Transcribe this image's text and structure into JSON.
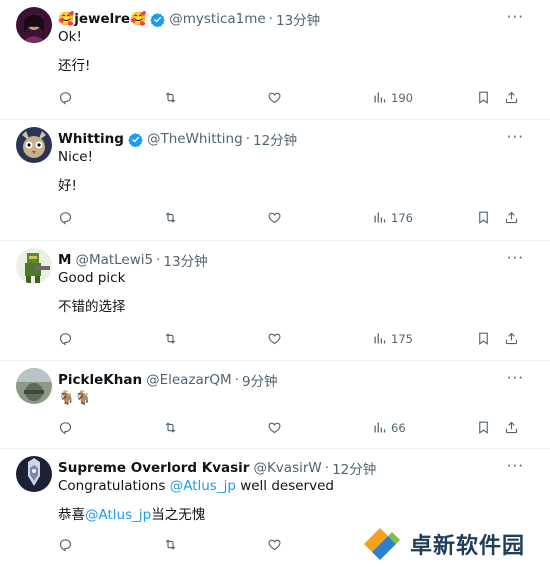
{
  "tweets": [
    {
      "name_prefix_emoji": "🥰",
      "name": "jewelre",
      "name_suffix_emoji": "🥰",
      "verified": true,
      "handle": "@mystica1me",
      "dot": "·",
      "time": "13分钟",
      "lines": [
        "Ok!",
        "还行!"
      ],
      "views": "190",
      "avatar_colors": [
        "#5a1f4a",
        "#caa07e"
      ]
    },
    {
      "name": "Whitting",
      "verified": true,
      "handle": "@TheWhitting",
      "dot": "·",
      "time": "12分钟",
      "lines": [
        "Nice!",
        "好!"
      ],
      "views": "176",
      "avatar_colors": [
        "#3a4b7a",
        "#e0c7a0"
      ]
    },
    {
      "name": "M",
      "verified": false,
      "handle": "@MatLewi5",
      "dot": "·",
      "time": "13分钟",
      "lines": [
        "Good pick",
        "不错的选择"
      ],
      "views": "175",
      "avatar_colors": [
        "#4a7a2e",
        "#8fae5a"
      ]
    },
    {
      "name": "PickleKhan",
      "verified": false,
      "handle": "@EleazarQM",
      "dot": "·",
      "time": "9分钟",
      "lines": [
        "🐐🐐"
      ],
      "views": "66",
      "avatar_colors": [
        "#6e7f6a",
        "#a9b7a2"
      ]
    },
    {
      "name": "Supreme Overlord Kvasir",
      "verified": false,
      "handle": "@KvasirW",
      "dot": "·",
      "time": "12分钟",
      "line1_a": "Congratulations ",
      "line1_link": "@Atlus_jp",
      "line1_b": " well deserved",
      "line2_a": "恭喜",
      "line2_link": "@Atlus_jp",
      "line2_b": "当之无愧",
      "avatar_colors": [
        "#2b2f4a",
        "#dfe3f0"
      ]
    }
  ],
  "more_label": "···",
  "watermark": {
    "text": "卓新软件园"
  },
  "colors": {
    "accent": "#1d9bf0",
    "muted": "#536471",
    "text": "#0f1419"
  }
}
